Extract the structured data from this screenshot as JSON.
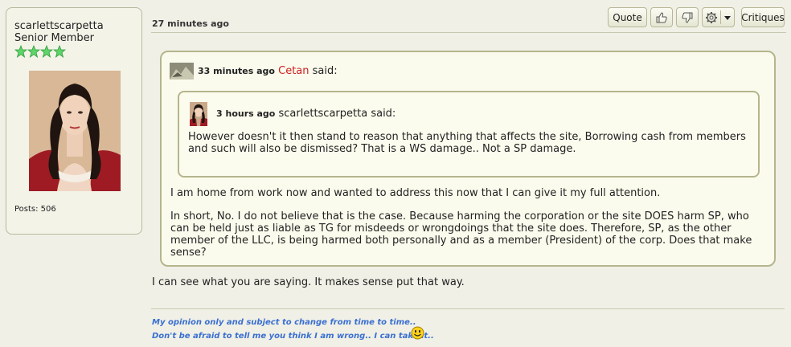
{
  "user": {
    "username": "scarlettscarpetta",
    "rank": "Senior Member",
    "star_count": 4,
    "posts_text": "Posts: 506"
  },
  "post": {
    "time": "27 minutes ago",
    "buttons": {
      "quote": "Quote",
      "critiques": "Critiques"
    },
    "icons": {
      "like": "thumbs-up-icon",
      "dislike": "thumbs-down-icon",
      "tools": "gear-icon",
      "dropdown": "caret-down-icon"
    }
  },
  "outer_quote": {
    "time": "33 minutes ago",
    "author": "Cetan",
    "said": "said:",
    "paragraph1": "I am home from work now and wanted to address this now that I can give it my full attention.",
    "paragraph2": "In short, No.  I do not believe that is the case.  Because harming the corporation or the site DOES harm SP, who can be held just as liable as TG for misdeeds or wrongdoings that the site does.  Therefore, SP, as  the other member of the LLC, is being harmed both personally and as a member (President) of the corp.  Does that make sense?"
  },
  "inner_quote": {
    "time": "3 hours ago",
    "author": "scarlettscarpetta",
    "said": "said:",
    "text": "However doesn't it then stand to reason that anything that affects the site, Borrowing cash from members and such will also be dismissed? That is a WS damage.. Not a SP damage."
  },
  "reply": {
    "text": "I can see what you are saying. It makes sense put that way."
  },
  "signature": {
    "line1": "My opinion only and subject to change from time to time..",
    "line2": "Don't be afraid to tell me you think I am wrong.. I can take it..",
    "icon": "smiley-icon"
  },
  "colors": {
    "background": "#f0f0e6",
    "quote_border": "#b5b58e",
    "author_link": "#cc1f1f",
    "signature": "#3a6fd1",
    "stars": "#5fd46a"
  }
}
